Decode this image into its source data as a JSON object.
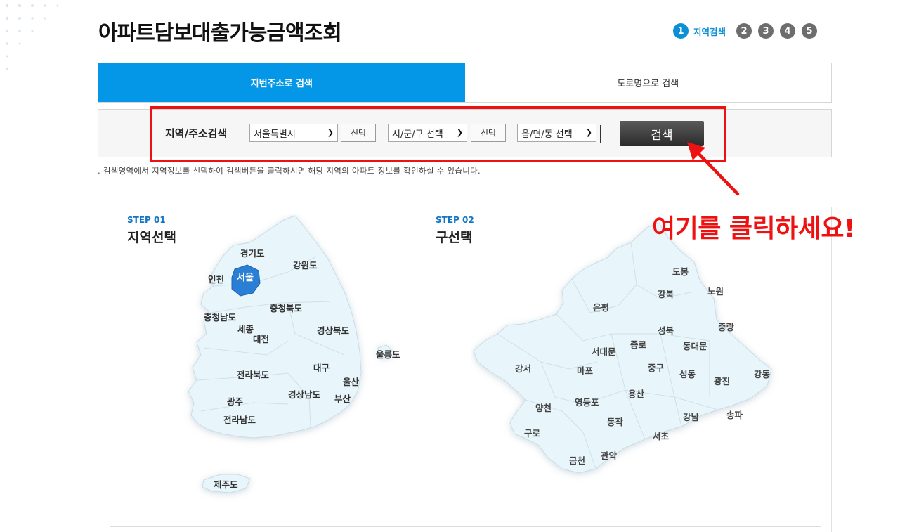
{
  "page_title": "아파트담보대출가능금액조회",
  "steps": {
    "active_label": "지역검색",
    "numbers": [
      "1",
      "2",
      "3",
      "4",
      "5"
    ]
  },
  "tabs": [
    {
      "label": "지번주소로 검색",
      "active": true
    },
    {
      "label": "도로명으로 검색",
      "active": false
    }
  ],
  "search": {
    "label": "지역/주소검색",
    "sido_select": "서울특별시",
    "sido_button": "선택",
    "sigungu_select": "시/군/구 선택",
    "sigungu_button": "선택",
    "dong_select": "읍/면/동 선택",
    "search_button": "검색"
  },
  "hint": ". 검색영역에서 지역정보를 선택하여 검색버튼을 클릭하시면 해당 지역의 아파트 정보를 확인하실 수 있습니다.",
  "callout": "여기를 클릭하세요!",
  "step1": {
    "kicker": "STEP 01",
    "title": "지역선택"
  },
  "step2": {
    "kicker": "STEP 02",
    "title": "구선택"
  },
  "korea_regions": [
    "경기도",
    "서울",
    "인천",
    "강원도",
    "충청북도",
    "충청남도",
    "세종",
    "대전",
    "경상북도",
    "울릉도",
    "전라북도",
    "대구",
    "울산",
    "경상남도",
    "부산",
    "광주",
    "전라남도",
    "제주도"
  ],
  "seoul_districts": [
    "도봉",
    "노원",
    "강북",
    "은평",
    "성북",
    "중랑",
    "서대문",
    "종로",
    "동대문",
    "강서",
    "마포",
    "중구",
    "성동",
    "광진",
    "강동",
    "양천",
    "영등포",
    "용산",
    "강남",
    "송파",
    "구로",
    "동작",
    "서초",
    "금천",
    "관악"
  ],
  "colors": {
    "accent": "#0497e8",
    "step_active": "#0d8fd6",
    "highlight": "#ee1111",
    "region_selected": "#2a7fd4",
    "map_fill": "#e8f6fb"
  }
}
